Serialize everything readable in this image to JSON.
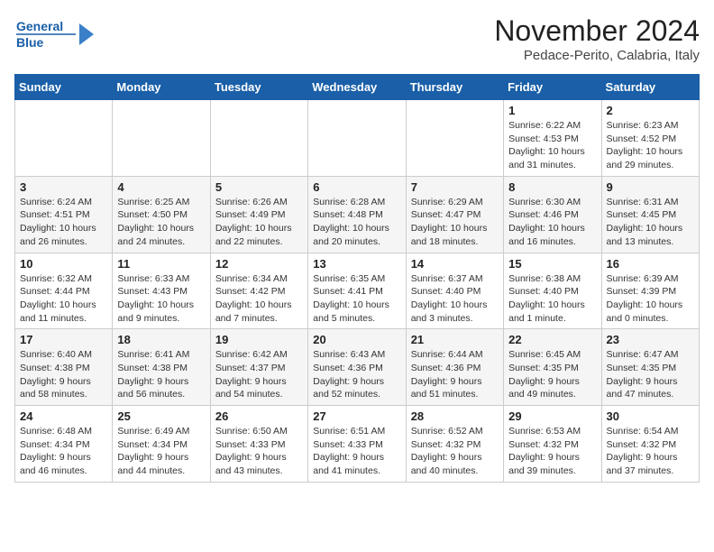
{
  "logo": {
    "line1": "General",
    "line2": "Blue"
  },
  "title": "November 2024",
  "subtitle": "Pedace-Perito, Calabria, Italy",
  "weekdays": [
    "Sunday",
    "Monday",
    "Tuesday",
    "Wednesday",
    "Thursday",
    "Friday",
    "Saturday"
  ],
  "weeks": [
    [
      {
        "day": "",
        "info": ""
      },
      {
        "day": "",
        "info": ""
      },
      {
        "day": "",
        "info": ""
      },
      {
        "day": "",
        "info": ""
      },
      {
        "day": "",
        "info": ""
      },
      {
        "day": "1",
        "info": "Sunrise: 6:22 AM\nSunset: 4:53 PM\nDaylight: 10 hours\nand 31 minutes."
      },
      {
        "day": "2",
        "info": "Sunrise: 6:23 AM\nSunset: 4:52 PM\nDaylight: 10 hours\nand 29 minutes."
      }
    ],
    [
      {
        "day": "3",
        "info": "Sunrise: 6:24 AM\nSunset: 4:51 PM\nDaylight: 10 hours\nand 26 minutes."
      },
      {
        "day": "4",
        "info": "Sunrise: 6:25 AM\nSunset: 4:50 PM\nDaylight: 10 hours\nand 24 minutes."
      },
      {
        "day": "5",
        "info": "Sunrise: 6:26 AM\nSunset: 4:49 PM\nDaylight: 10 hours\nand 22 minutes."
      },
      {
        "day": "6",
        "info": "Sunrise: 6:28 AM\nSunset: 4:48 PM\nDaylight: 10 hours\nand 20 minutes."
      },
      {
        "day": "7",
        "info": "Sunrise: 6:29 AM\nSunset: 4:47 PM\nDaylight: 10 hours\nand 18 minutes."
      },
      {
        "day": "8",
        "info": "Sunrise: 6:30 AM\nSunset: 4:46 PM\nDaylight: 10 hours\nand 16 minutes."
      },
      {
        "day": "9",
        "info": "Sunrise: 6:31 AM\nSunset: 4:45 PM\nDaylight: 10 hours\nand 13 minutes."
      }
    ],
    [
      {
        "day": "10",
        "info": "Sunrise: 6:32 AM\nSunset: 4:44 PM\nDaylight: 10 hours\nand 11 minutes."
      },
      {
        "day": "11",
        "info": "Sunrise: 6:33 AM\nSunset: 4:43 PM\nDaylight: 10 hours\nand 9 minutes."
      },
      {
        "day": "12",
        "info": "Sunrise: 6:34 AM\nSunset: 4:42 PM\nDaylight: 10 hours\nand 7 minutes."
      },
      {
        "day": "13",
        "info": "Sunrise: 6:35 AM\nSunset: 4:41 PM\nDaylight: 10 hours\nand 5 minutes."
      },
      {
        "day": "14",
        "info": "Sunrise: 6:37 AM\nSunset: 4:40 PM\nDaylight: 10 hours\nand 3 minutes."
      },
      {
        "day": "15",
        "info": "Sunrise: 6:38 AM\nSunset: 4:40 PM\nDaylight: 10 hours\nand 1 minute."
      },
      {
        "day": "16",
        "info": "Sunrise: 6:39 AM\nSunset: 4:39 PM\nDaylight: 10 hours\nand 0 minutes."
      }
    ],
    [
      {
        "day": "17",
        "info": "Sunrise: 6:40 AM\nSunset: 4:38 PM\nDaylight: 9 hours\nand 58 minutes."
      },
      {
        "day": "18",
        "info": "Sunrise: 6:41 AM\nSunset: 4:38 PM\nDaylight: 9 hours\nand 56 minutes."
      },
      {
        "day": "19",
        "info": "Sunrise: 6:42 AM\nSunset: 4:37 PM\nDaylight: 9 hours\nand 54 minutes."
      },
      {
        "day": "20",
        "info": "Sunrise: 6:43 AM\nSunset: 4:36 PM\nDaylight: 9 hours\nand 52 minutes."
      },
      {
        "day": "21",
        "info": "Sunrise: 6:44 AM\nSunset: 4:36 PM\nDaylight: 9 hours\nand 51 minutes."
      },
      {
        "day": "22",
        "info": "Sunrise: 6:45 AM\nSunset: 4:35 PM\nDaylight: 9 hours\nand 49 minutes."
      },
      {
        "day": "23",
        "info": "Sunrise: 6:47 AM\nSunset: 4:35 PM\nDaylight: 9 hours\nand 47 minutes."
      }
    ],
    [
      {
        "day": "24",
        "info": "Sunrise: 6:48 AM\nSunset: 4:34 PM\nDaylight: 9 hours\nand 46 minutes."
      },
      {
        "day": "25",
        "info": "Sunrise: 6:49 AM\nSunset: 4:34 PM\nDaylight: 9 hours\nand 44 minutes."
      },
      {
        "day": "26",
        "info": "Sunrise: 6:50 AM\nSunset: 4:33 PM\nDaylight: 9 hours\nand 43 minutes."
      },
      {
        "day": "27",
        "info": "Sunrise: 6:51 AM\nSunset: 4:33 PM\nDaylight: 9 hours\nand 41 minutes."
      },
      {
        "day": "28",
        "info": "Sunrise: 6:52 AM\nSunset: 4:32 PM\nDaylight: 9 hours\nand 40 minutes."
      },
      {
        "day": "29",
        "info": "Sunrise: 6:53 AM\nSunset: 4:32 PM\nDaylight: 9 hours\nand 39 minutes."
      },
      {
        "day": "30",
        "info": "Sunrise: 6:54 AM\nSunset: 4:32 PM\nDaylight: 9 hours\nand 37 minutes."
      }
    ]
  ]
}
